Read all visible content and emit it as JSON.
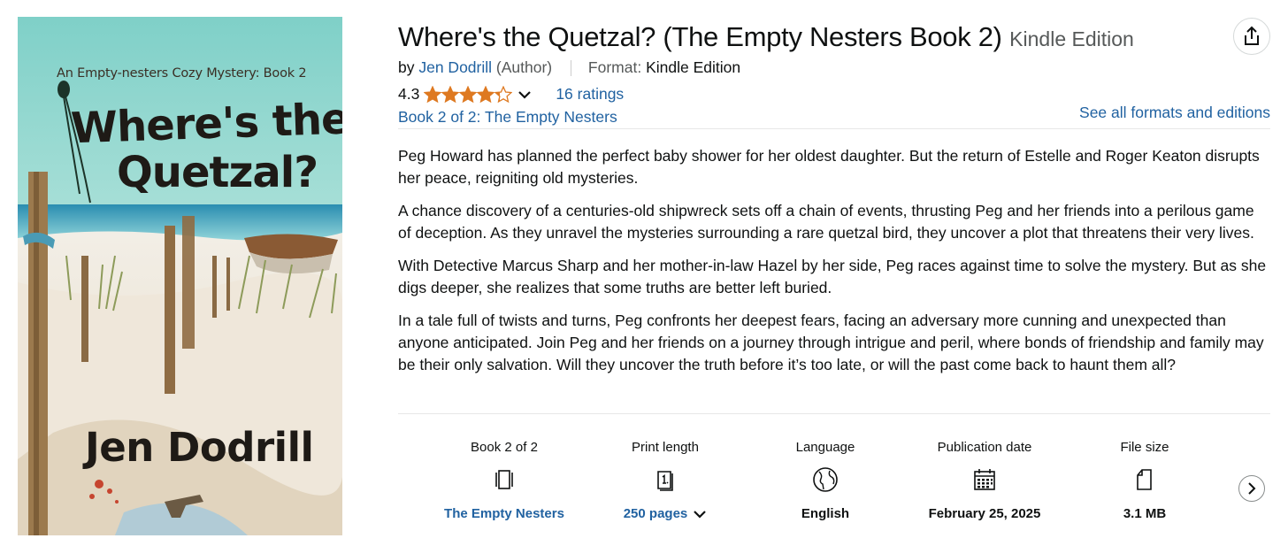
{
  "cover": {
    "series_text": "An Empty-nesters Cozy Mystery: Book 2",
    "title_line1": "Where's the",
    "title_line2": "Quetzal?",
    "author": "Jen Dodrill"
  },
  "product": {
    "title": "Where's the Quetzal? (The Empty Nesters Book 2)",
    "edition": "Kindle Edition",
    "by_prefix": "by",
    "author_name": "Jen Dodrill",
    "author_role": "(Author)",
    "format_label": "Format:",
    "format_value": "Kindle Edition",
    "rating_value": "4.3",
    "rating_stars": 4.3,
    "ratings_count": "16 ratings",
    "series_link": "Book 2 of 2: The Empty Nesters",
    "formats_link": "See all formats and editions"
  },
  "description": [
    "Peg Howard has planned the perfect baby shower for her oldest daughter. But the return of Estelle and Roger Keaton disrupts her peace, reigniting old mysteries.",
    "A chance discovery of a centuries-old shipwreck sets off a chain of events, thrusting Peg and her friends into a perilous game of deception. As they unravel the mysteries surrounding a rare quetzal bird, they uncover a plot that threatens their very lives.",
    "With Detective Marcus Sharp and her mother-in-law Hazel by her side, Peg races against time to solve the mystery. But as she digs deeper, she realizes that some truths are better left buried.",
    "In a tale full of twists and turns, Peg confronts her deepest fears, facing an adversary more cunning and unexpected than anyone anticipated. Join Peg and her friends on a journey through intrigue and peril, where bonds of friendship and family may be their only salvation. Will they uncover the truth before it’s too late, or will the past come back to haunt them all?"
  ],
  "details": [
    {
      "label": "Book 2 of 2",
      "icon": "book-series-icon",
      "value": "The Empty Nesters"
    },
    {
      "label": "Print length",
      "icon": "book-pages-icon",
      "value": "250 pages"
    },
    {
      "label": "Language",
      "icon": "globe-icon",
      "value": "English"
    },
    {
      "label": "Publication date",
      "icon": "calendar-icon",
      "value": "February 25, 2025"
    },
    {
      "label": "File size",
      "icon": "file-icon",
      "value": "3.1 MB"
    }
  ],
  "colors": {
    "link": "#2162a1",
    "star": "#de7921",
    "text": "#0f1111",
    "muted": "#565959"
  }
}
